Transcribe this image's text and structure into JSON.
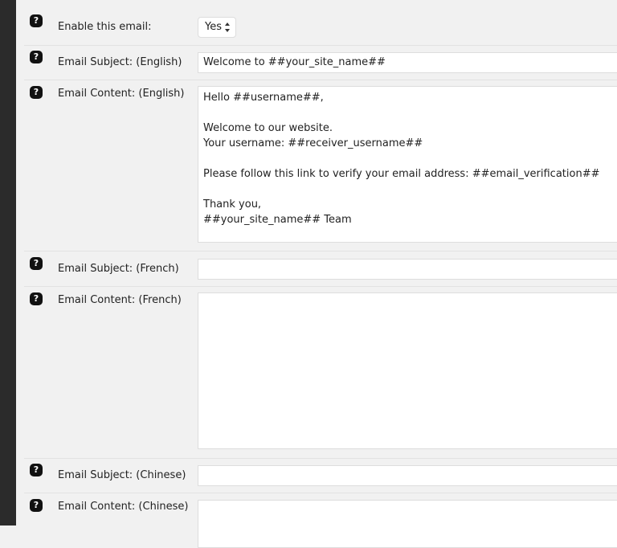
{
  "form": {
    "enable_email": {
      "label": "Enable this email:",
      "value": "Yes"
    },
    "subject_en": {
      "label": "Email Subject: (English)",
      "value": "Welcome to ##your_site_name##"
    },
    "content_en": {
      "label": "Email Content: (English)",
      "value": "Hello ##username##,\n\nWelcome to our website.\nYour username: ##receiver_username##\n\nPlease follow this link to verify your email address: ##email_verification##\n\nThank you,\n##your_site_name## Team"
    },
    "subject_fr": {
      "label": "Email Subject: (French)",
      "value": ""
    },
    "content_fr": {
      "label": "Email Content: (French)",
      "value": ""
    },
    "subject_zh": {
      "label": "Email Subject: (Chinese)",
      "value": ""
    },
    "content_zh": {
      "label": "Email Content: (Chinese)",
      "value": ""
    }
  },
  "help_icon_glyph": "?"
}
